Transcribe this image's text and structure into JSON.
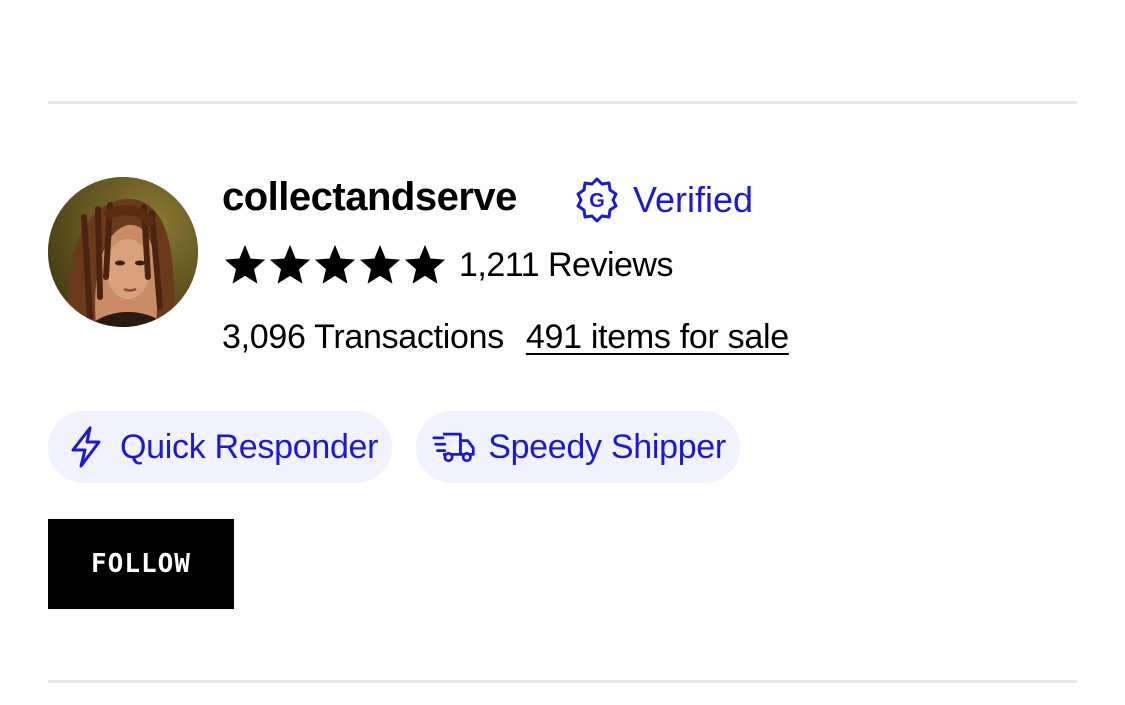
{
  "colors": {
    "accent": "#1a1ad6",
    "badge_bg": "#f1f2fd",
    "button_bg": "#000000"
  },
  "seller": {
    "username": "collectandserve",
    "verified_label": "Verified",
    "verified_icon": "verified-g-badge-icon",
    "rating_stars": 5,
    "rating_max": 5,
    "reviews_text": "1,211 Reviews",
    "transactions_text": "3,096 Transactions",
    "items_link_text": "491 items for sale",
    "avatar_icon": "seller-avatar"
  },
  "badges": [
    {
      "label": "Quick Responder",
      "icon": "lightning-bolt-icon"
    },
    {
      "label": "Speedy Shipper",
      "icon": "delivery-truck-icon"
    }
  ],
  "actions": {
    "follow_label": "FOLLOW"
  }
}
